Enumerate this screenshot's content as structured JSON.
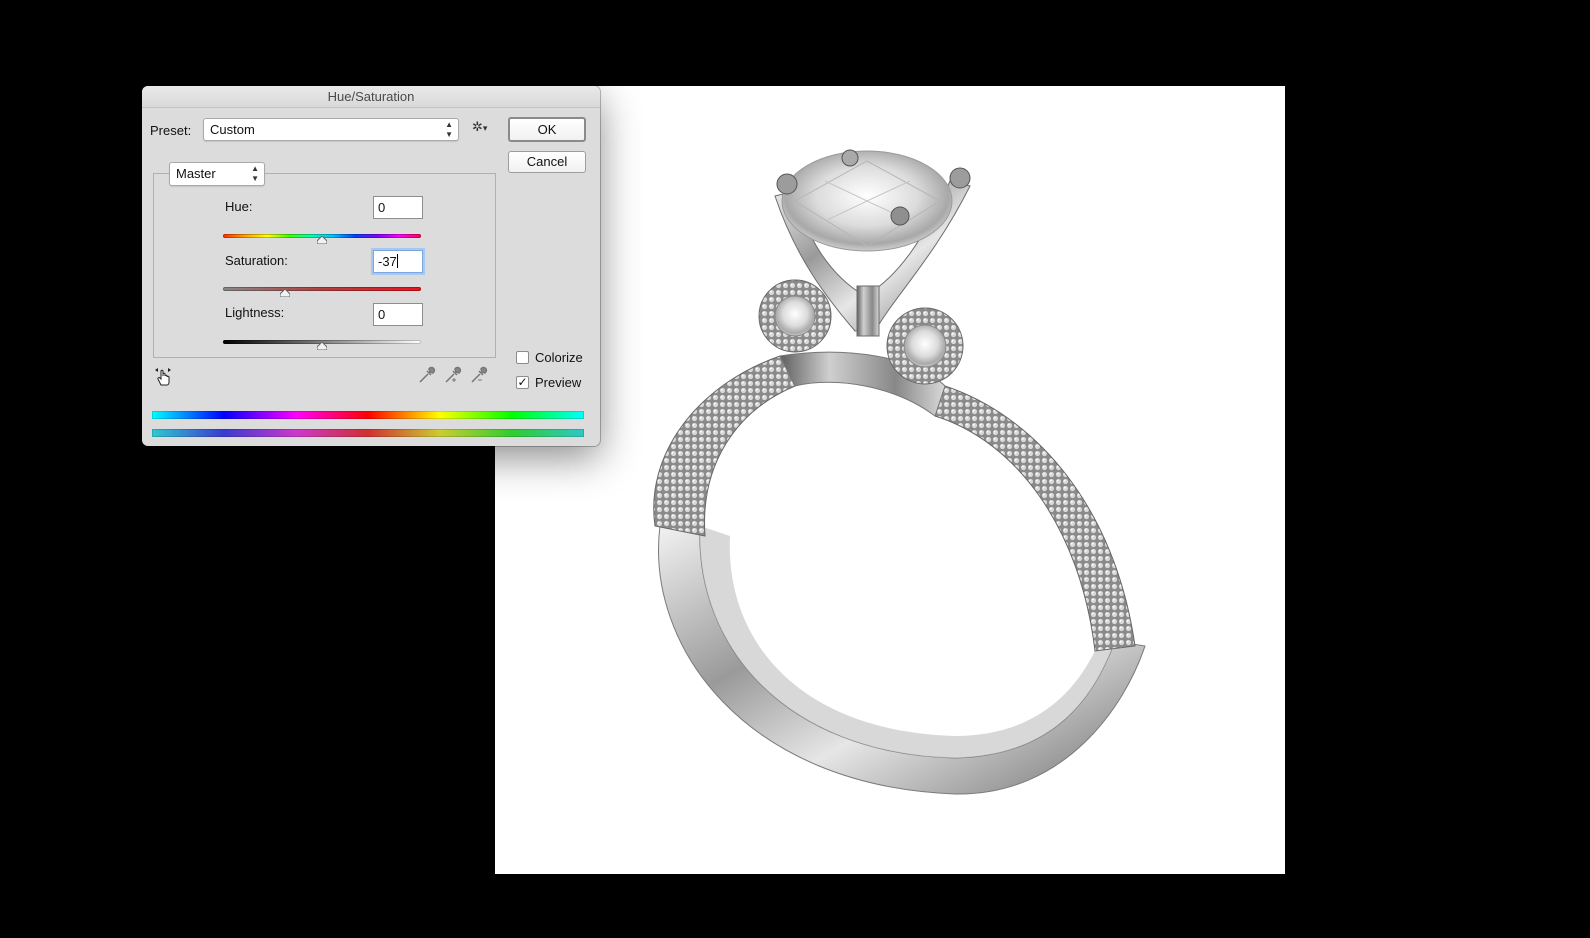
{
  "dialog": {
    "title": "Hue/Saturation",
    "preset_label": "Preset:",
    "preset_value": "Custom",
    "ok_label": "OK",
    "cancel_label": "Cancel",
    "channel_value": "Master",
    "hue": {
      "label": "Hue:",
      "value": "0",
      "position": 0.5
    },
    "saturation": {
      "label": "Saturation:",
      "value": "-37",
      "position": 0.315
    },
    "lightness": {
      "label": "Lightness:",
      "value": "0",
      "position": 0.5
    },
    "colorize": {
      "label": "Colorize",
      "checked": false
    },
    "preview": {
      "label": "Preview",
      "checked": true
    },
    "icons": {
      "gear": "gear-icon",
      "hand": "targeted-adjustment-hand-icon",
      "eyedropper": "eyedropper-icon",
      "eyedropper_add": "eyedropper-plus-icon",
      "eyedropper_subtract": "eyedropper-minus-icon"
    }
  },
  "canvas": {
    "subject": "silver engagement ring with round diamond on white background"
  },
  "colors": {
    "background": "#000000",
    "dialog_bg": "#dcdcdc",
    "canvas_bg": "#ffffff",
    "focus_ring": "#a9c8f0"
  }
}
